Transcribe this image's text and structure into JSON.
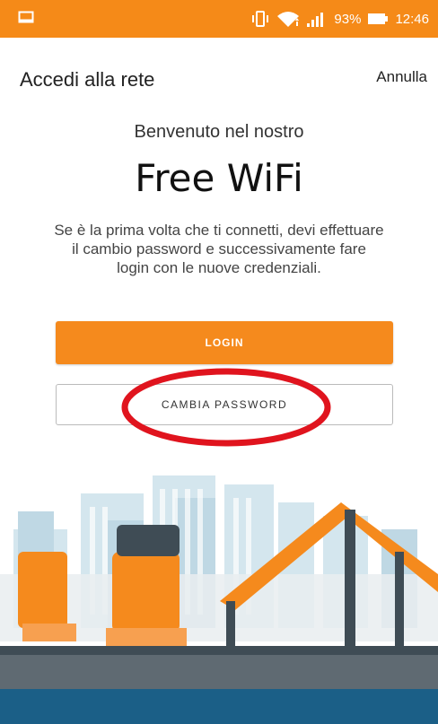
{
  "status_bar": {
    "battery": "93%",
    "time": "12:46",
    "icons": [
      "image-icon",
      "vibrate-icon",
      "wifi-icon",
      "signal-icon",
      "battery-icon"
    ]
  },
  "app_bar": {
    "title": "Accedi alla rete",
    "cancel_label": "Annulla"
  },
  "content": {
    "welcome": "Benvenuto nel nostro",
    "heading": "Free WiFi",
    "description": "Se è la prima volta che ti connetti, devi effettuare il cambio password e successivamente fare login con le nuove credenziali."
  },
  "buttons": {
    "login": "LOGIN",
    "change_password": "CAMBIA PASSWORD"
  },
  "colors": {
    "accent": "#f58a18",
    "bottom_bar": "#1b5f87",
    "highlight": "#e0141e"
  }
}
